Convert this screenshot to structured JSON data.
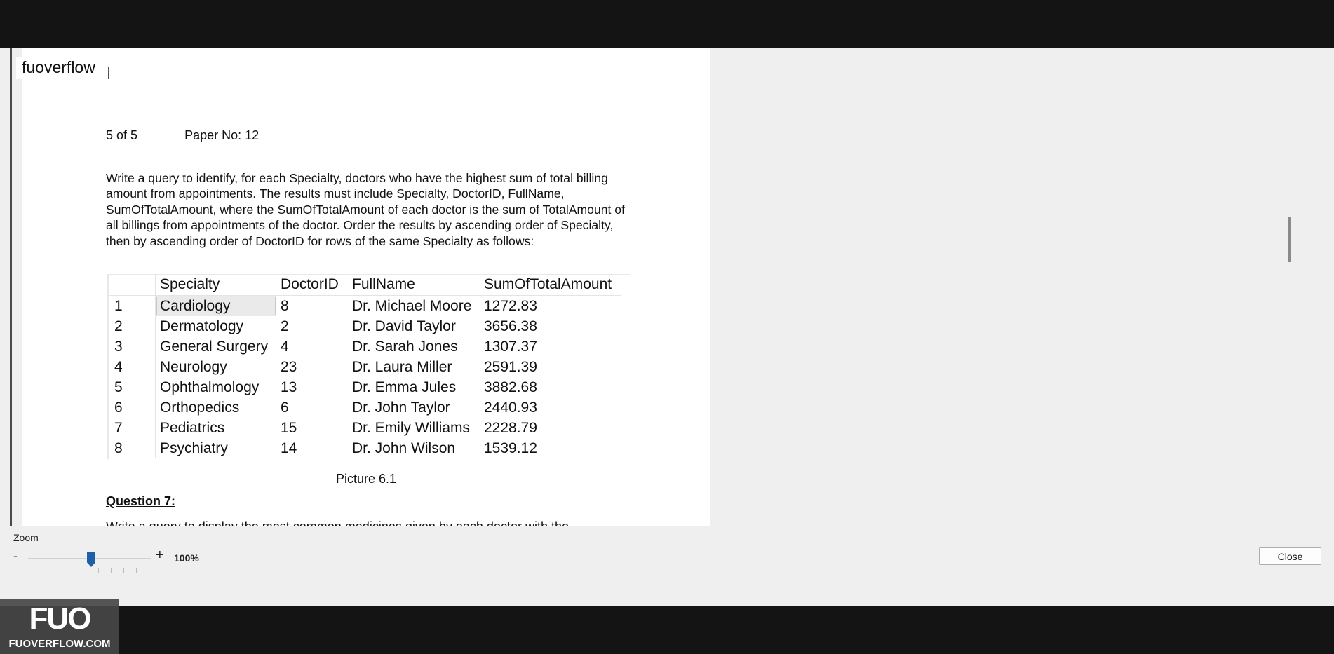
{
  "document": {
    "name": "fuoverflow",
    "page_counter": "5 of 5",
    "paper_no": "Paper No: 12",
    "question_text": "Write a query to identify, for each Specialty, doctors who have the highest sum of total billing amount from appointments. The results must include Specialty, DoctorID, FullName, SumOfTotalAmount, where the SumOfTotalAmount of each doctor is the sum of TotalAmount of all billings from appointments of the doctor. Order the results by ascending order of Specialty, then by ascending order of DoctorID for rows of the same Specialty as follows:",
    "table": {
      "headers": [
        "",
        "Specialty",
        "DoctorID",
        "FullName",
        "SumOfTotalAmount"
      ],
      "rows": [
        [
          "1",
          "Cardiology",
          "8",
          "Dr. Michael Moore",
          "1272.83"
        ],
        [
          "2",
          "Dermatology",
          "2",
          "Dr. David Taylor",
          "3656.38"
        ],
        [
          "3",
          "General Surgery",
          "4",
          "Dr. Sarah Jones",
          "1307.37"
        ],
        [
          "4",
          "Neurology",
          "23",
          "Dr. Laura Miller",
          "2591.39"
        ],
        [
          "5",
          "Ophthalmology",
          "13",
          "Dr. Emma Jules",
          "3882.68"
        ],
        [
          "6",
          "Orthopedics",
          "6",
          "Dr. John Taylor",
          "2440.93"
        ],
        [
          "7",
          "Pediatrics",
          "15",
          "Dr. Emily Williams",
          "2228.79"
        ],
        [
          "8",
          "Psychiatry",
          "14",
          "Dr. John Wilson",
          "1539.12"
        ]
      ]
    },
    "caption": "Picture 6.1",
    "next_heading": "Question 7:",
    "next_line_partial": "Write a query to display the most common medicines given by each doctor with the"
  },
  "zoom": {
    "label": "Zoom",
    "minus": "-",
    "plus": "+",
    "value": "100%",
    "level_percent": 100
  },
  "close_label": "Close",
  "watermark": {
    "logo": "FUO",
    "text": "FUOVERFLOW.COM"
  }
}
